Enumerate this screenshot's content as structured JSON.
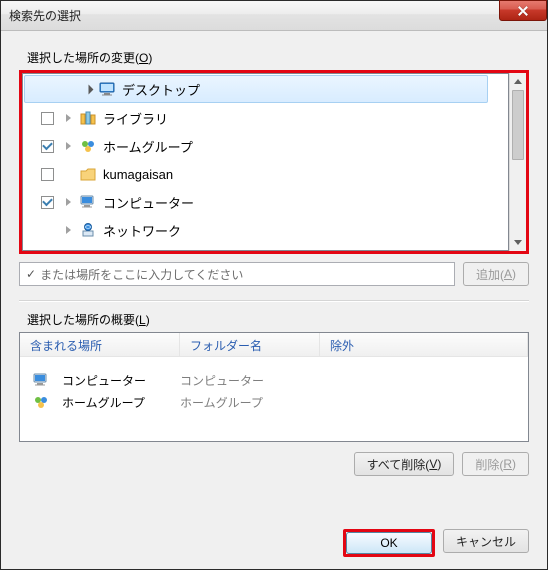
{
  "title": "検索先の選択",
  "group_change_label": "選択した場所の変更(",
  "group_change_accel": "O",
  "group_change_label_end": ")",
  "tree": {
    "items": [
      {
        "label": "デスクトップ",
        "icon": "desktop-icon"
      },
      {
        "label": "ライブラリ",
        "icon": "libraries-icon"
      },
      {
        "label": "ホームグループ",
        "icon": "homegroup-icon"
      },
      {
        "label": "kumagaisan",
        "icon": "user-folder-icon"
      },
      {
        "label": "コンピューター",
        "icon": "computer-icon"
      },
      {
        "label": "ネットワーク",
        "icon": "network-icon"
      }
    ]
  },
  "path_placeholder": "または場所をここに入力してください",
  "add_button": "追加(",
  "add_button_accel": "A",
  "add_button_end": ")",
  "group_summary_label": "選択した場所の概要(",
  "group_summary_accel": "L",
  "group_summary_end": ")",
  "columns": {
    "c1": "含まれる場所",
    "c2": "フォルダー名",
    "c3": "除外"
  },
  "summary": [
    {
      "name": "コンピューター",
      "folder": "コンピューター",
      "icon": "computer-icon"
    },
    {
      "name": "ホームグループ",
      "folder": "ホームグループ",
      "icon": "homegroup-icon"
    }
  ],
  "delete_all": "すべて削除(",
  "delete_all_accel": "V",
  "delete_all_end": ")",
  "delete_btn": "削除(",
  "delete_btn_accel": "R",
  "delete_btn_end": ")",
  "ok": "OK",
  "cancel": "キャンセル"
}
